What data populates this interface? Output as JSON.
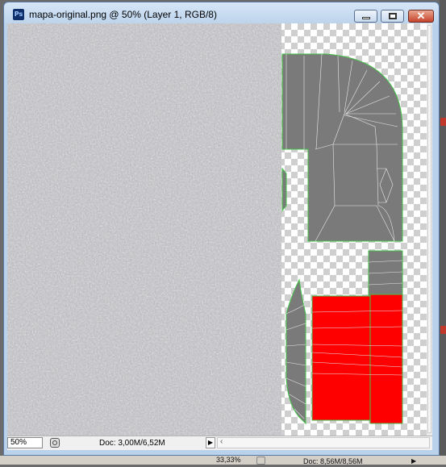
{
  "window": {
    "title": "mapa-original.png @ 50% (Layer 1, RGB/8)",
    "app_icon": "Ps"
  },
  "titlebar_buttons": {
    "minimize_icon": "minimize-icon",
    "maximize_icon": "maximize-icon",
    "close_icon": "close-icon"
  },
  "status_bar": {
    "zoom": "50%",
    "doc": "Doc: 3,00M/6,52M"
  },
  "background_window": {
    "zoom": "33,33%",
    "doc": "Doc: 8,56M/8,56M"
  },
  "colors": {
    "uv_fill": "#7a7a7a",
    "uv_edge": "#45c34a",
    "highlight": "#ff0000"
  }
}
